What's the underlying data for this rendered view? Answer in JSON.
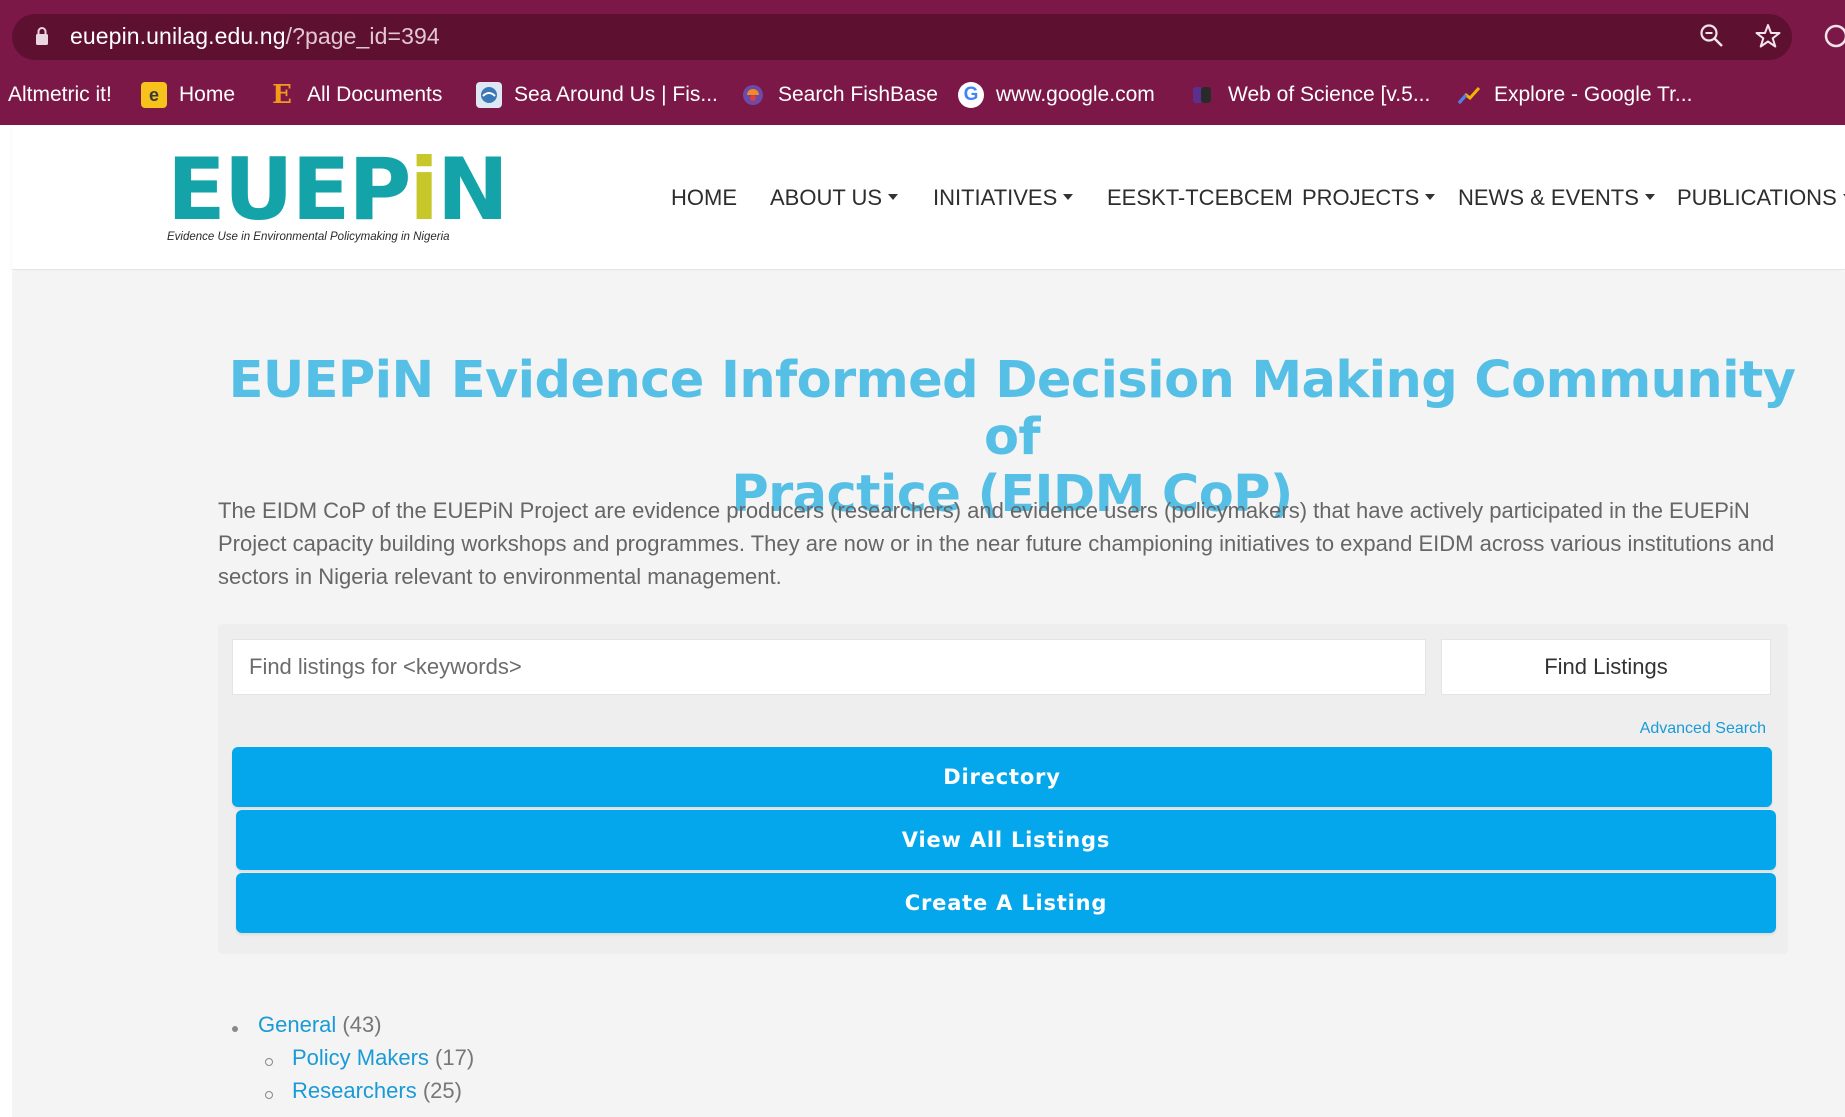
{
  "browser": {
    "url_host": "euepin.unilag.edu.ng",
    "url_path": "/?page_id=394",
    "icons": [
      "lock-icon",
      "zoom-icon",
      "star-icon",
      "profile-icon"
    ],
    "bookmarks": [
      {
        "label": "Altmetric it!",
        "icon": ""
      },
      {
        "label": "Home",
        "icon": "e-home-icon"
      },
      {
        "label": "All Documents",
        "icon": "e-documents-icon"
      },
      {
        "label": "Sea Around Us | Fis...",
        "icon": "sea-around-us-icon"
      },
      {
        "label": "Search FishBase",
        "icon": "fishbase-icon"
      },
      {
        "label": "www.google.com",
        "icon": "google-icon"
      },
      {
        "label": "Web of Science [v.5...",
        "icon": "web-of-science-icon"
      },
      {
        "label": "Explore - Google Tr...",
        "icon": "google-trends-icon"
      }
    ]
  },
  "site": {
    "logo_text_a": "EUEP",
    "logo_text_i": "i",
    "logo_text_b": "N",
    "logo_tagline": "Evidence Use in Environmental Policymaking in Nigeria",
    "nav": [
      {
        "label": "HOME",
        "dropdown": false
      },
      {
        "label": "ABOUT US",
        "dropdown": true
      },
      {
        "label": "INITIATIVES",
        "dropdown": true
      },
      {
        "label": "EESKT-TCEBCEM",
        "dropdown": false
      },
      {
        "label": "PROJECTS",
        "dropdown": true
      },
      {
        "label": "NEWS & EVENTS",
        "dropdown": true
      },
      {
        "label": "PUBLICATIONS",
        "dropdown": true
      }
    ]
  },
  "page": {
    "title_line1": "EUEPiN Evidence Informed Decision Making Community of",
    "title_line2": "Practice (EIDM CoP)",
    "intro": "The EIDM CoP of the EUEPiN Project are evidence producers (researchers) and evidence users (policymakers) that have actively participated in the EUEPiN Project capacity building workshops and programmes. They are now or in the near future championing initiatives to expand EIDM across various institutions and sectors in Nigeria relevant to environmental management.",
    "search": {
      "placeholder": "Find listings for <keywords>",
      "button": "Find Listings",
      "advanced": "Advanced Search"
    },
    "buttons": {
      "directory": "Directory",
      "view_all": "View All Listings",
      "create": "Create A Listing"
    },
    "categories": [
      {
        "label": "General",
        "count": "(43)",
        "level": 0
      },
      {
        "label": "Policy Makers",
        "count": "(17)",
        "level": 1
      },
      {
        "label": "Researchers",
        "count": "(25)",
        "level": 1
      }
    ],
    "colors": {
      "title": "#55bfe5",
      "button": "#05a7ec",
      "link": "#1a9ad6",
      "browser_bar": "#7c1847",
      "logo_teal": "#13a3a8",
      "logo_yellow": "#c7c72a"
    }
  }
}
